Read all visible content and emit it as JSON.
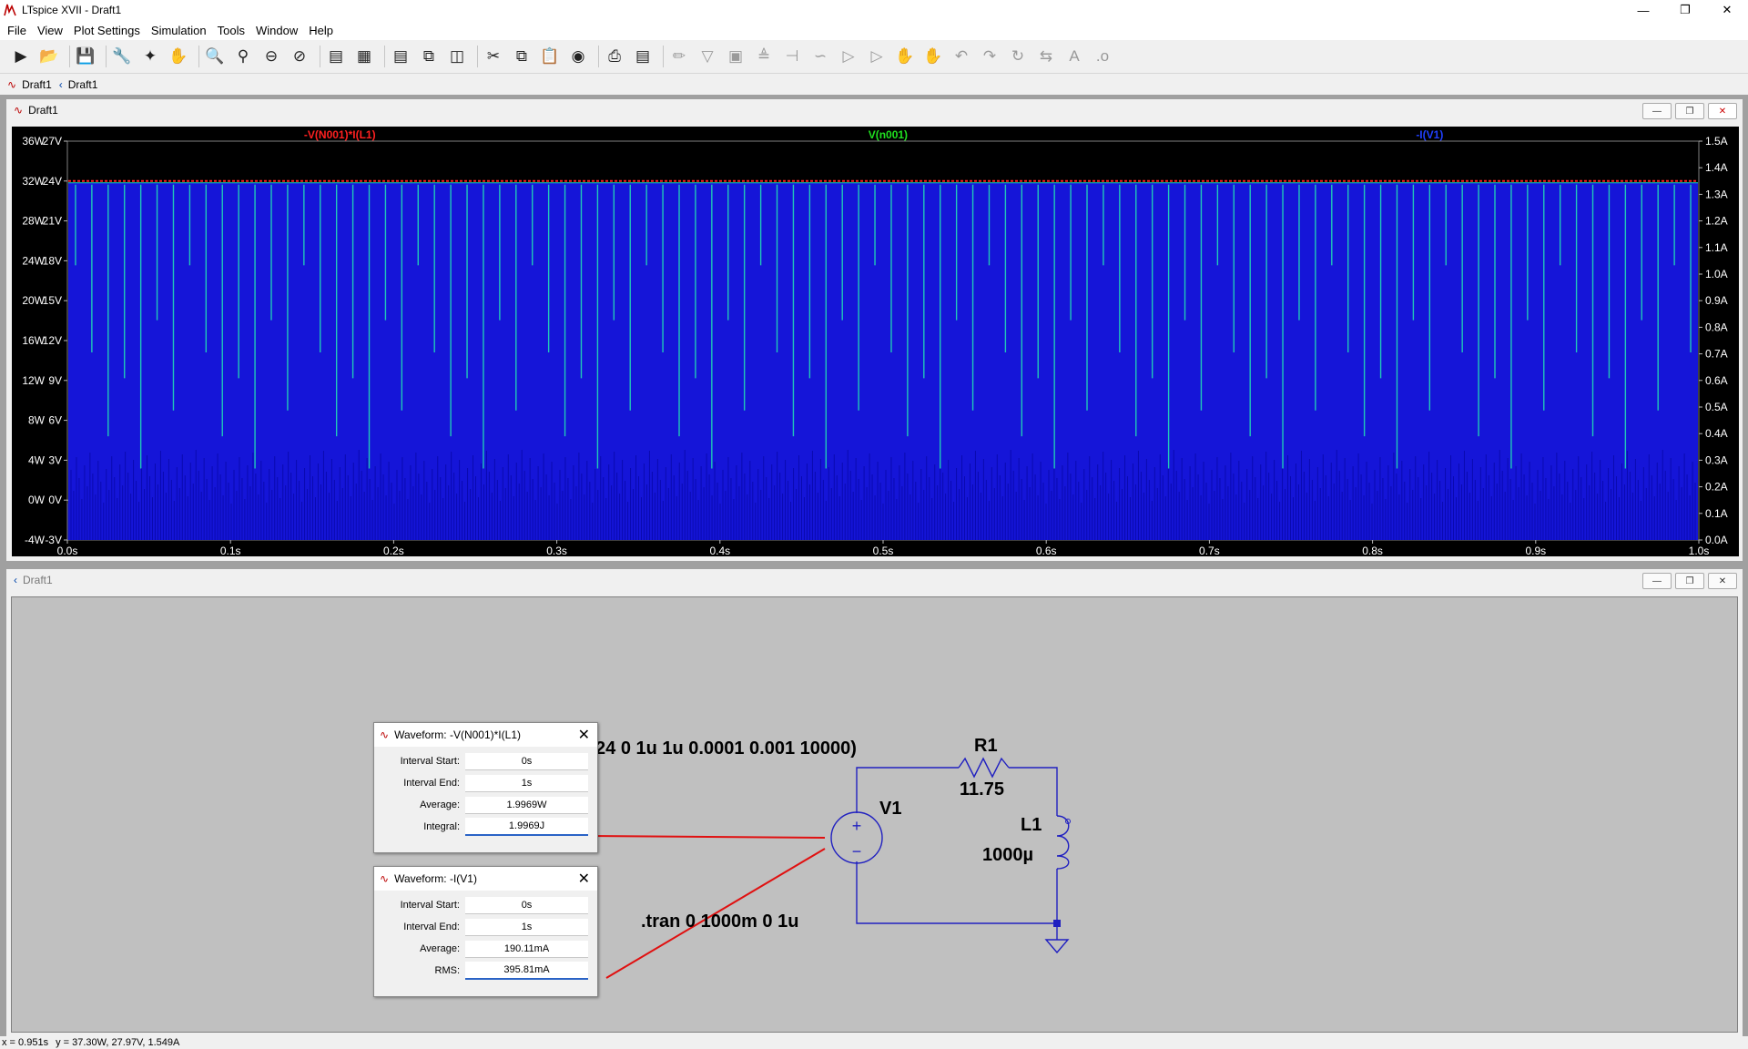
{
  "window": {
    "title": "LTspice XVII - Draft1"
  },
  "menu": [
    "File",
    "View",
    "Plot Settings",
    "Simulation",
    "Tools",
    "Window",
    "Help"
  ],
  "toolbar_icons": [
    "run-icon",
    "open-icon",
    "save-icon",
    "control-panel-icon",
    "halt-icon",
    "pan-icon",
    "zoom-in-icon",
    "zoom-area-icon",
    "zoom-out-icon",
    "zoom-full-icon",
    "autorange-icon",
    "plot-settings-icon",
    "tile-horizontal-icon",
    "cascade-icon",
    "tile-vertical-icon",
    "cut-icon",
    "copy-icon",
    "paste-icon",
    "find-icon",
    "print-icon",
    "print-preview-icon",
    "draw-wire-icon",
    "ground-icon",
    "label-net-icon",
    "resistor-icon",
    "capacitor-icon",
    "inductor-icon",
    "diode-icon",
    "component-icon",
    "move-icon",
    "drag-icon",
    "undo-icon",
    "redo-icon",
    "rotate-icon",
    "mirror-icon",
    "text-icon",
    "spice-directive-icon"
  ],
  "tabs": [
    {
      "label": "Draft1",
      "icon": "waveform-tab-icon"
    },
    {
      "label": "Draft1",
      "icon": "schematic-tab-icon"
    }
  ],
  "plot_window": {
    "title": "Draft1"
  },
  "schematic_window": {
    "title": "Draft1"
  },
  "chart_data": {
    "type": "line",
    "traces": [
      {
        "name": "-V(N001)*I(L1)",
        "color": "#ff2020",
        "value": 24,
        "axis": "left-W"
      },
      {
        "name": "V(n001)",
        "color": "#20e020",
        "value": 24,
        "axis": "left-V"
      },
      {
        "name": "-I(V1)",
        "color": "#2040ff",
        "axis": "right-A"
      }
    ],
    "left_axis_W": [
      "36W",
      "32W",
      "28W",
      "24W",
      "20W",
      "16W",
      "12W",
      "8W",
      "4W",
      "0W",
      "-4W"
    ],
    "left_axis_V": [
      "27V",
      "24V",
      "21V",
      "18V",
      "15V",
      "12V",
      "9V",
      "6V",
      "3V",
      "0V",
      "-3V"
    ],
    "right_axis_A": [
      "1.5A",
      "1.4A",
      "1.3A",
      "1.2A",
      "1.1A",
      "1.0A",
      "0.9A",
      "0.8A",
      "0.7A",
      "0.6A",
      "0.5A",
      "0.4A",
      "0.3A",
      "0.2A",
      "0.1A",
      "0.0A"
    ],
    "x_ticks": [
      "0.0s",
      "0.1s",
      "0.2s",
      "0.3s",
      "0.4s",
      "0.5s",
      "0.6s",
      "0.7s",
      "0.8s",
      "0.9s",
      "1.0s"
    ],
    "xlim": [
      0,
      1
    ],
    "ylim_V": [
      -3,
      27
    ],
    "ylim_A": [
      0,
      1.5
    ],
    "pulses": 100,
    "grid": true
  },
  "schematic": {
    "source_value": "PULSE(0 24 0 1u 1u 0.0001 0.001 10000)",
    "source_name": "V1",
    "resistor_name": "R1",
    "resistor_value": "11.75",
    "inductor_name": "L1",
    "inductor_value": "1000µ",
    "directive": ".tran 0 1000m 0 1u",
    "wire_color": "#2020c0"
  },
  "dialogs": [
    {
      "title": "Waveform: -V(N001)*I(L1)",
      "rows": [
        {
          "label": "Interval Start:",
          "value": "0s"
        },
        {
          "label": "Interval End:",
          "value": "1s"
        },
        {
          "label": "Average:",
          "value": "1.9969W"
        },
        {
          "label": "Integral:",
          "value": "1.9969J"
        }
      ]
    },
    {
      "title": "Waveform: -I(V1)",
      "rows": [
        {
          "label": "Interval Start:",
          "value": "0s"
        },
        {
          "label": "Interval End:",
          "value": "1s"
        },
        {
          "label": "Average:",
          "value": "190.11mA"
        },
        {
          "label": "RMS:",
          "value": "395.81mA"
        }
      ]
    }
  ],
  "status": {
    "x": "x = 0.951s",
    "y": "y = 37.30W, 27.97V, 1.549A"
  }
}
